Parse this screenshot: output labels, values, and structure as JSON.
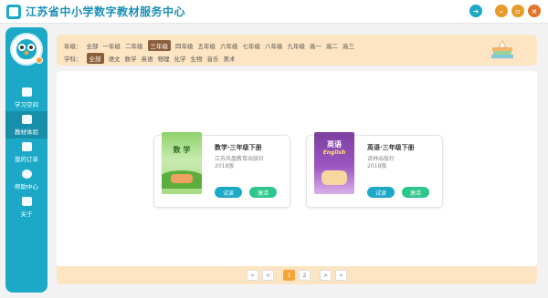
{
  "app": {
    "title": "江苏省中小学数字教材服务中心"
  },
  "window_buttons": {
    "arrow_icon": "arrow-right-icon",
    "minimize_icon": "minimize-icon",
    "maximize_icon": "maximize-icon",
    "close_icon": "close-icon"
  },
  "sidebar": {
    "items": [
      {
        "label": "学习空间",
        "icon": "notebook-icon"
      },
      {
        "label": "教材体验",
        "icon": "book-icon"
      },
      {
        "label": "我的订单",
        "icon": "order-icon"
      },
      {
        "label": "帮助中心",
        "icon": "help-icon"
      },
      {
        "label": "关于",
        "icon": "info-icon"
      }
    ],
    "active_index": 1
  },
  "filter": {
    "grade_label": "年级：",
    "grades": [
      "全部",
      "一年级",
      "二年级",
      "三年级",
      "四年级",
      "五年级",
      "六年级",
      "七年级",
      "八年级",
      "九年级",
      "高一",
      "高二",
      "高三"
    ],
    "grade_selected": "三年级",
    "subject_label": "学科：",
    "subjects": [
      "全部",
      "语文",
      "数学",
      "英语",
      "物理",
      "化学",
      "生物",
      "音乐",
      "美术"
    ],
    "subject_selected": "全部"
  },
  "books": [
    {
      "title": "数学·三年级下册",
      "publisher": "江苏凤凰教育出版社",
      "year": "2018版",
      "cover_title": "数 学",
      "try_label": "试读",
      "activate_label": "激活"
    },
    {
      "title": "英语·三年级下册",
      "publisher": "译林出版社",
      "year": "2018版",
      "cover_title": "英语",
      "cover_sub": "English",
      "try_label": "试读",
      "activate_label": "激活"
    }
  ],
  "pagination": {
    "first": "«",
    "prev": "<",
    "pages": [
      "1",
      "2"
    ],
    "current": "1",
    "next": ">",
    "last": "»"
  },
  "colors": {
    "primary": "#1ba9c7",
    "accent": "#f3a53b",
    "filter_bg": "#fde4c2",
    "activate": "#2ec68b"
  }
}
